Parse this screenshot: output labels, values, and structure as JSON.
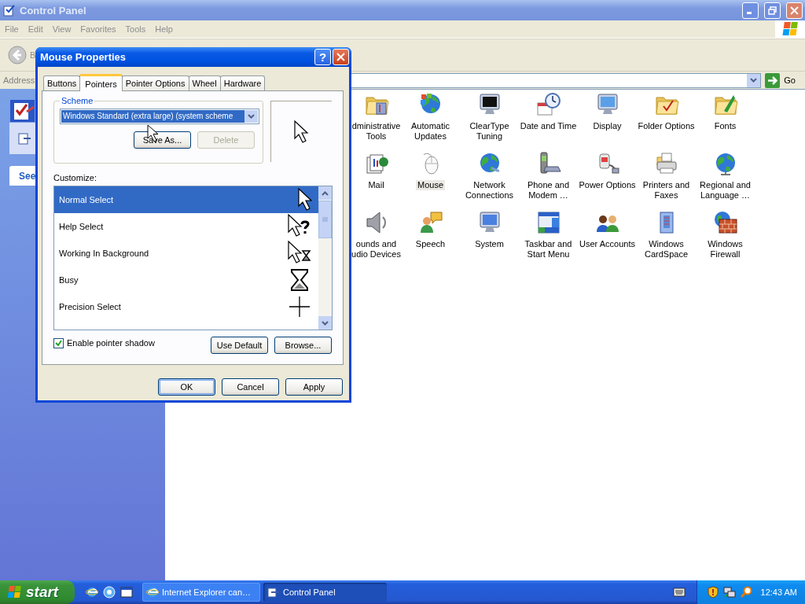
{
  "window": {
    "title": "Control Panel",
    "active": false
  },
  "menu": [
    "File",
    "Edit",
    "View",
    "Favorites",
    "Tools",
    "Help"
  ],
  "toolbar": {
    "back": "B"
  },
  "address": {
    "label": "Address",
    "go": "Go"
  },
  "task_pane": {
    "button": "See"
  },
  "items": [
    {
      "lines": [
        "dministrative",
        "Tools"
      ],
      "selected": false
    },
    {
      "lines": [
        "Automatic",
        "Updates"
      ],
      "selected": false
    },
    {
      "lines": [
        "ClearType",
        "Tuning"
      ],
      "selected": false
    },
    {
      "lines": [
        "Date and Time"
      ],
      "selected": false
    },
    {
      "lines": [
        "Display"
      ],
      "selected": false
    },
    {
      "lines": [
        "Folder Options"
      ],
      "selected": false
    },
    {
      "lines": [
        "Fonts"
      ],
      "selected": false
    },
    {
      "lines": [
        "Mail"
      ],
      "selected": false
    },
    {
      "lines": [
        "Mouse"
      ],
      "selected": true
    },
    {
      "lines": [
        "Network",
        "Connections"
      ],
      "selected": false
    },
    {
      "lines": [
        "Phone and",
        "Modem …"
      ],
      "selected": false
    },
    {
      "lines": [
        "Power Options"
      ],
      "selected": false
    },
    {
      "lines": [
        "Printers and",
        "Faxes"
      ],
      "selected": false
    },
    {
      "lines": [
        "Regional and",
        "Language …"
      ],
      "selected": false
    },
    {
      "lines": [
        "ounds and",
        "udio Devices"
      ],
      "selected": false
    },
    {
      "lines": [
        "Speech"
      ],
      "selected": false
    },
    {
      "lines": [
        "System"
      ],
      "selected": false
    },
    {
      "lines": [
        "Taskbar and",
        "Start Menu"
      ],
      "selected": false
    },
    {
      "lines": [
        "User Accounts"
      ],
      "selected": false
    },
    {
      "lines": [
        "Windows",
        "CardSpace"
      ],
      "selected": false
    },
    {
      "lines": [
        "Windows",
        "Firewall"
      ],
      "selected": false
    }
  ],
  "dialog": {
    "title": "Mouse Properties",
    "help_button": "?",
    "tabs": [
      {
        "label": "Buttons",
        "selected": false
      },
      {
        "label": "Pointers",
        "selected": true
      },
      {
        "label": "Pointer Options",
        "selected": false
      },
      {
        "label": "Wheel",
        "selected": false
      },
      {
        "label": "Hardware",
        "selected": false
      }
    ],
    "scheme": {
      "legend": "Scheme",
      "value": "Windows Standard (extra large) (system scheme",
      "buttons": [
        {
          "label": "Save As...",
          "disabled": false
        },
        {
          "label": "Delete",
          "disabled": true
        }
      ]
    },
    "customize_label": "Customize:",
    "pointers": [
      {
        "name": "Normal Select",
        "kind": "arrow",
        "selected": true
      },
      {
        "name": "Help Select",
        "kind": "help",
        "selected": false
      },
      {
        "name": "Working In Background",
        "kind": "working",
        "selected": false
      },
      {
        "name": "Busy",
        "kind": "busy",
        "selected": false
      },
      {
        "name": "Precision Select",
        "kind": "cross",
        "selected": false
      }
    ],
    "shadow": {
      "label": "Enable pointer shadow",
      "checked": true
    },
    "list_buttons": [
      "Use Default",
      "Browse..."
    ],
    "buttons": [
      "OK",
      "Cancel",
      "Apply"
    ]
  },
  "taskbar": {
    "start": "start",
    "tasks": [
      {
        "label": "Internet Explorer can…",
        "selected": false
      },
      {
        "label": "Control Panel",
        "selected": true
      }
    ],
    "clock": "12:43 AM"
  }
}
